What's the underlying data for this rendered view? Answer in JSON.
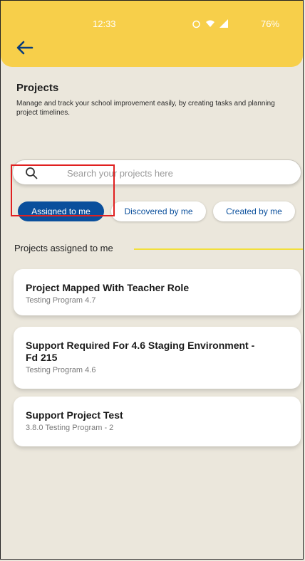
{
  "status_bar": {
    "time": "12:33",
    "battery": "76%"
  },
  "header": {
    "back_icon": "arrow-left-icon"
  },
  "page": {
    "title": "Projects",
    "subtitle": "Manage and track your school improvement easily, by creating tasks and planning project timelines."
  },
  "search": {
    "placeholder": "Search your projects here",
    "icon": "search-icon"
  },
  "filters": [
    {
      "label": "Assigned to me",
      "active": true
    },
    {
      "label": "Discovered by me",
      "active": false
    },
    {
      "label": "Created by me",
      "active": false
    }
  ],
  "section": {
    "title": "Projects assigned to me"
  },
  "projects": [
    {
      "title": "Project Mapped With Teacher Role",
      "program": "Testing Program 4.7"
    },
    {
      "title": "Support Required For 4.6 Staging Environment - Fd 215",
      "program": "Testing Program 4.6"
    },
    {
      "title": "Support Project Test",
      "program": "3.8.0 Testing Program - 2"
    }
  ],
  "colors": {
    "header": "#f7cf4a",
    "accent": "#0a4f9c",
    "background": "#ebe7dc",
    "highlight": "#e02020"
  }
}
